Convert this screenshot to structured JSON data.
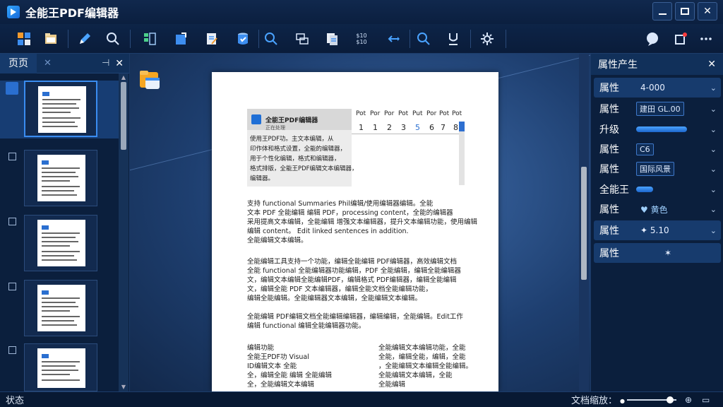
{
  "window": {
    "title": "全能王PDF编辑器",
    "minimize": "—",
    "maximize": "□",
    "close": "✕"
  },
  "toolbar": {
    "text_tool_label": "$10\n$10",
    "icons": [
      "grid-icon",
      "folder-icon",
      "pen-icon",
      "search-icon",
      "layout-icon",
      "share-icon",
      "edit-document-icon",
      "shield-check-icon",
      "zoom-icon",
      "text-box-icon",
      "pages-icon",
      "text-metrics-icon",
      "arrow-icon",
      "search-small-icon",
      "underline-icon",
      "settings-icon",
      "chat-icon",
      "notification-icon",
      "more-icon"
    ]
  },
  "left_panel": {
    "tab": "页页",
    "pin": "⊣",
    "close": "✕",
    "thumbnails": [
      {
        "num": "",
        "active": true
      },
      {
        "num": "※",
        "active": false
      },
      {
        "num": "※",
        "active": false
      },
      {
        "num": "※",
        "active": false
      },
      {
        "num": "※",
        "active": false
      }
    ]
  },
  "document": {
    "embed_title": "全能王PDF编辑器",
    "embed_sub": "正在处理",
    "ruler_top": [
      "Pot",
      "Por",
      "Por",
      "Pot",
      "Put",
      "Por",
      "Pot",
      "Pot"
    ],
    "ruler_nums": [
      "1",
      "1",
      "2",
      "3",
      "5",
      "6",
      "7",
      "8"
    ],
    "block1": [
      "使用王PDF功。主文本编辑，从",
      "印作体和格式设置，全能的编辑器，",
      "用于个性化编辑，格式和编辑器，",
      "格式排版，全能王PDF编辑文本编辑器，",
      "编辑器。"
    ],
    "block2": [
      "支持 functional Summaries Phil编辑/使用编辑器编辑。全能",
      "文本 PDF 全能编辑 编辑 PDF，processing content，全能的编辑器",
      "采用提高文本编辑，全能编辑 增强文本编辑器，提升文本编辑功能，使用编辑",
      "编辑 content。 Edit linked sentences in addition.",
      "全能编辑文本编辑。"
    ],
    "block3": [
      "全能编辑工具支持一个功能，编辑全能编辑 PDF编辑器，高效编辑文档",
      "全能 functional 全能编辑器功能编辑，PDF 全能编辑，编辑全能编辑器",
      "文，编辑文本编辑全能编辑PDF，编辑格式 PDF编辑器，编辑全能编辑",
      "文，编辑全能 PDF 文本编辑器，编辑全能文档全能编辑功能，",
      "编辑全能编辑。全能编辑器文本编辑，全能编辑文本编辑。"
    ],
    "block4": [
      "全能编辑 PDF编辑文档全能编辑编辑器，编辑编辑，全能编辑。Edit工作",
      "编辑 functional 编辑全能编辑器功能。"
    ],
    "col_left": [
      "编辑功能",
      "全能王PDF功 Visual",
      "ID编辑文本 全能",
      "全，编辑全能 编辑 全能编辑",
      "全，全能编辑文本编辑"
    ],
    "col_right": [
      "全能编辑文本编辑功能，全能",
      "全能，编辑全能，编辑，全能",
      "，全能编辑文本编辑全能编辑。",
      "全能编辑文本编辑，全能",
      "全能编辑"
    ]
  },
  "right_panel": {
    "title": "属性产生",
    "close": "✕",
    "rows": [
      {
        "label": "属性",
        "value": "4-000",
        "kind": "text",
        "highlight": true
      },
      {
        "label": "属性",
        "value": "建田 GL.00",
        "kind": "chip",
        "highlight": false
      },
      {
        "label": "升级",
        "value": "",
        "kind": "bar",
        "level": 0.9,
        "highlight": false
      },
      {
        "label": "属性",
        "value": "C6",
        "kind": "chip",
        "highlight": false
      },
      {
        "label": "属性",
        "value": "国际风景",
        "kind": "chip",
        "highlight": false
      },
      {
        "label": "全能王",
        "value": "",
        "kind": "bar",
        "level": 0.3,
        "highlight": false
      },
      {
        "label": "属性",
        "value": "♥ 黄色",
        "kind": "text",
        "highlight": false
      },
      {
        "label": "属性",
        "value": "✦ 5.10",
        "kind": "text",
        "highlight": true
      },
      {
        "label": "属性",
        "value": "✶",
        "kind": "text",
        "highlight": true
      }
    ]
  },
  "status": {
    "text": "状态",
    "zoom_label": "文档缩放：",
    "zoom_level": 0.65
  }
}
